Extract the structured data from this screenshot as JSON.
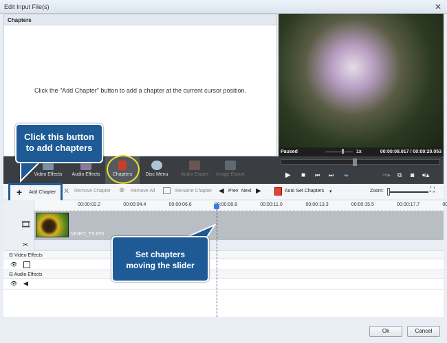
{
  "window": {
    "title": "Edit Input File(s)",
    "close_icon": "close-icon"
  },
  "chapters_panel": {
    "header": "Chapters",
    "hint": "Click the \"Add Chapter\" button to add a chapter at the current cursor position."
  },
  "player": {
    "status": "Paused",
    "speed": "1x",
    "time": "00:00:08.917 / 00:00:20.053",
    "seek_fraction": 0.45,
    "speed_fraction": 0.6
  },
  "tools": [
    {
      "label": "Video Effects",
      "icon": "video-effects-icon",
      "enabled": true
    },
    {
      "label": "Audio Effects",
      "icon": "audio-effects-icon",
      "enabled": true
    },
    {
      "label": "Chapters",
      "icon": "chapters-icon",
      "enabled": true,
      "active": true
    },
    {
      "label": "Disc Menu",
      "icon": "disc-menu-icon",
      "enabled": true
    },
    {
      "label": "Audio Export",
      "icon": "audio-export-icon",
      "enabled": false
    },
    {
      "label": "Image Export",
      "icon": "image-export-icon",
      "enabled": false
    }
  ],
  "chapter_toolbar": {
    "add": "Add Chapter",
    "remove": "Remove Chapter",
    "remove_all": "Remove All",
    "rename": "Rename Chapter",
    "prev": "Prev",
    "next": "Next",
    "auto": "Auto Set Chapters",
    "zoom": "Zoom:"
  },
  "ruler": [
    "00:00:02.2",
    "00:00:04.4",
    "00:00:06.6",
    "00:00:08.8",
    "00:00:11.0",
    "00:00:13.3",
    "00:00:15.5",
    "00:00:17.7",
    "00:00:"
  ],
  "timeline": {
    "clip_name": "VIDEO_TS.IFO",
    "video_effects": "Video Effects",
    "audio_effects": "Audio Effects"
  },
  "callouts": {
    "add": "Click this button to add chapters",
    "slider": "Set chapters moving the slider"
  },
  "buttons": {
    "ok": "Ok",
    "cancel": "Cancel"
  }
}
